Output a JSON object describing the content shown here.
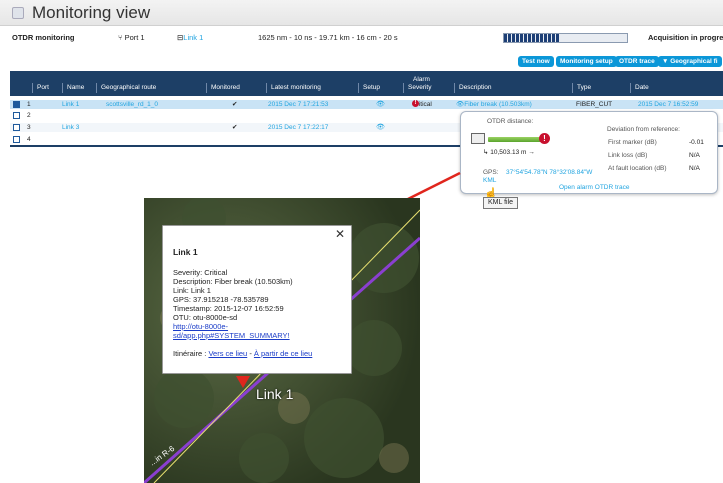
{
  "title": "Monitoring view",
  "toolbar": {
    "otdr_monitoring": "OTDR monitoring",
    "port": "Port 1",
    "link": "Link 1",
    "acq_params": "1625 nm - 10 ns - 19.71 km - 16 cm - 20 s",
    "acq_status": "Acquisition in progress",
    "progress": 0.45
  },
  "actions": [
    "Test now",
    "Monitoring setup",
    "OTDR trace",
    "▼ Geographical fi"
  ],
  "table": {
    "alarm_group": "Alarm",
    "headers": [
      "Port",
      "Name",
      "Geographical route",
      "Monitored",
      "Latest monitoring",
      "Setup",
      "Severity",
      "Description",
      "Type",
      "Date"
    ],
    "rows": [
      {
        "port": "1",
        "name": "Link 1",
        "route": "scottsville_rd_1_0",
        "monitored": "✔",
        "latest": "2015 Dec 7 17:21:53",
        "setup": "👁",
        "severity": "Critical",
        "description": "Fiber break (10.503km)",
        "type": "FIBER_CUT",
        "date": "2015 Dec 7 16:52:59"
      },
      {
        "port": "2",
        "name": "",
        "route": "",
        "monitored": "",
        "latest": "",
        "setup": "",
        "severity": "",
        "description": "",
        "type": "",
        "date": ""
      },
      {
        "port": "3",
        "name": "Link 3",
        "route": "",
        "monitored": "✔",
        "latest": "2015 Dec 7 17:22:17",
        "setup": "👁",
        "severity": "",
        "description": "",
        "type": "",
        "date": ""
      },
      {
        "port": "4",
        "name": "",
        "route": "",
        "monitored": "",
        "latest": "",
        "setup": "",
        "severity": "",
        "description": "",
        "type": "",
        "date": ""
      }
    ]
  },
  "popup": {
    "otdr_distance": "OTDR distance:",
    "distance": "10,503.13 m",
    "deviation_title": "Deviation from reference:",
    "first_marker_label": "First marker (dB)",
    "first_marker_value": "-0.01",
    "link_loss_label": "Link loss (dB)",
    "link_loss_value": "N/A",
    "fault_location_label": "At fault location (dB)",
    "fault_location_value": "N/A",
    "gps_label": "GPS:",
    "gps_value": "37°54'54.78\"N 78°32'08.84\"W",
    "kml": "KML",
    "open_trace": "Open alarm OTDR trace",
    "tooltip": "KML file"
  },
  "map": {
    "title": "Link 1",
    "severity": "Severity: Critical",
    "description": "Description: Fiber break (10.503km)",
    "link": "Link: Link 1",
    "gps": "GPS: 37.915218 -78.535789",
    "timestamp": "Timestamp: 2015-12-07 16:52:59",
    "otu": "OTU: otu-8000e-sd",
    "url_line1": "http://otu-8000e-",
    "url_line2": "sd/app.php#SYSTEM_SUMMARY!",
    "itinerary_label": "Itinéraire :",
    "to_here": "Vers ce lieu",
    "separator": "-",
    "from_here": "À partir de ce lieu",
    "marker_label": "Link 1",
    "road_label": "...in R-6"
  },
  "colors": {
    "header_bg": "#1d3f66",
    "accent": "#0b97d8",
    "critical": "#c8102e"
  }
}
